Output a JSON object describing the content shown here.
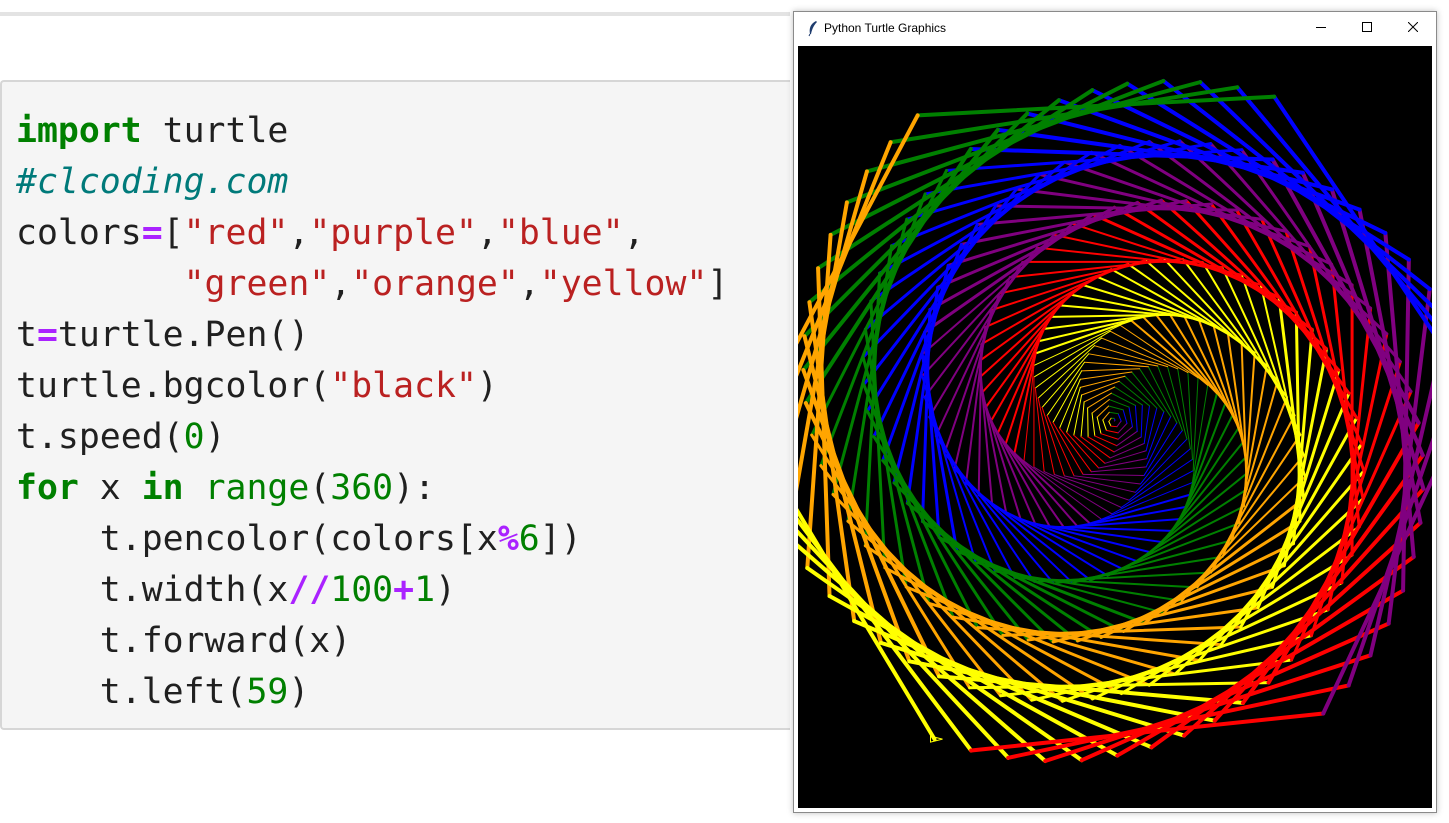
{
  "code_cell": {
    "lines": [
      [
        {
          "t": "import",
          "c": "kw"
        },
        {
          "t": " turtle",
          "c": "tx"
        }
      ],
      [
        {
          "t": "#clcoding.com",
          "c": "cm"
        }
      ],
      [
        {
          "t": "colors",
          "c": "tx"
        },
        {
          "t": "=",
          "c": "op"
        },
        {
          "t": "[",
          "c": "tx"
        },
        {
          "t": "\"red\"",
          "c": "st"
        },
        {
          "t": ",",
          "c": "tx"
        },
        {
          "t": "\"purple\"",
          "c": "st"
        },
        {
          "t": ",",
          "c": "tx"
        },
        {
          "t": "\"blue\"",
          "c": "st"
        },
        {
          "t": ",",
          "c": "tx"
        }
      ],
      [
        {
          "t": "        ",
          "c": "tx"
        },
        {
          "t": "\"green\"",
          "c": "st"
        },
        {
          "t": ",",
          "c": "tx"
        },
        {
          "t": "\"orange\"",
          "c": "st"
        },
        {
          "t": ",",
          "c": "tx"
        },
        {
          "t": "\"yellow\"",
          "c": "st"
        },
        {
          "t": "]",
          "c": "tx"
        }
      ],
      [
        {
          "t": "t",
          "c": "tx"
        },
        {
          "t": "=",
          "c": "op"
        },
        {
          "t": "turtle.Pen()",
          "c": "tx"
        }
      ],
      [
        {
          "t": "turtle.bgcolor(",
          "c": "tx"
        },
        {
          "t": "\"black\"",
          "c": "st"
        },
        {
          "t": ")",
          "c": "tx"
        }
      ],
      [
        {
          "t": "t.speed(",
          "c": "tx"
        },
        {
          "t": "0",
          "c": "nu"
        },
        {
          "t": ")",
          "c": "tx"
        }
      ],
      [
        {
          "t": "for",
          "c": "kw"
        },
        {
          "t": " x ",
          "c": "tx"
        },
        {
          "t": "in",
          "c": "kw"
        },
        {
          "t": " ",
          "c": "tx"
        },
        {
          "t": "range",
          "c": "bi"
        },
        {
          "t": "(",
          "c": "tx"
        },
        {
          "t": "360",
          "c": "nu"
        },
        {
          "t": "):",
          "c": "tx"
        }
      ],
      [
        {
          "t": "    t.pencolor(colors[x",
          "c": "tx"
        },
        {
          "t": "%",
          "c": "op"
        },
        {
          "t": "6",
          "c": "nu"
        },
        {
          "t": "])",
          "c": "tx"
        }
      ],
      [
        {
          "t": "    t.width(x",
          "c": "tx"
        },
        {
          "t": "//",
          "c": "op"
        },
        {
          "t": "100",
          "c": "nu"
        },
        {
          "t": "+",
          "c": "op"
        },
        {
          "t": "1",
          "c": "nu"
        },
        {
          "t": ")",
          "c": "tx"
        }
      ],
      [
        {
          "t": "    t.forward(x)",
          "c": "tx"
        }
      ],
      [
        {
          "t": "    t.left(",
          "c": "tx"
        },
        {
          "t": "59",
          "c": "nu"
        },
        {
          "t": ")",
          "c": "tx"
        }
      ]
    ]
  },
  "window": {
    "title": "Python Turtle Graphics",
    "icon": "feather-icon",
    "buttons": [
      "minimize-icon",
      "maximize-icon",
      "close-icon"
    ]
  },
  "turtle": {
    "background": "#000000",
    "colors": [
      "red",
      "purple",
      "blue",
      "green",
      "orange",
      "yellow"
    ],
    "steps": 360,
    "turn_degrees": 59,
    "width_divisor": 100
  }
}
